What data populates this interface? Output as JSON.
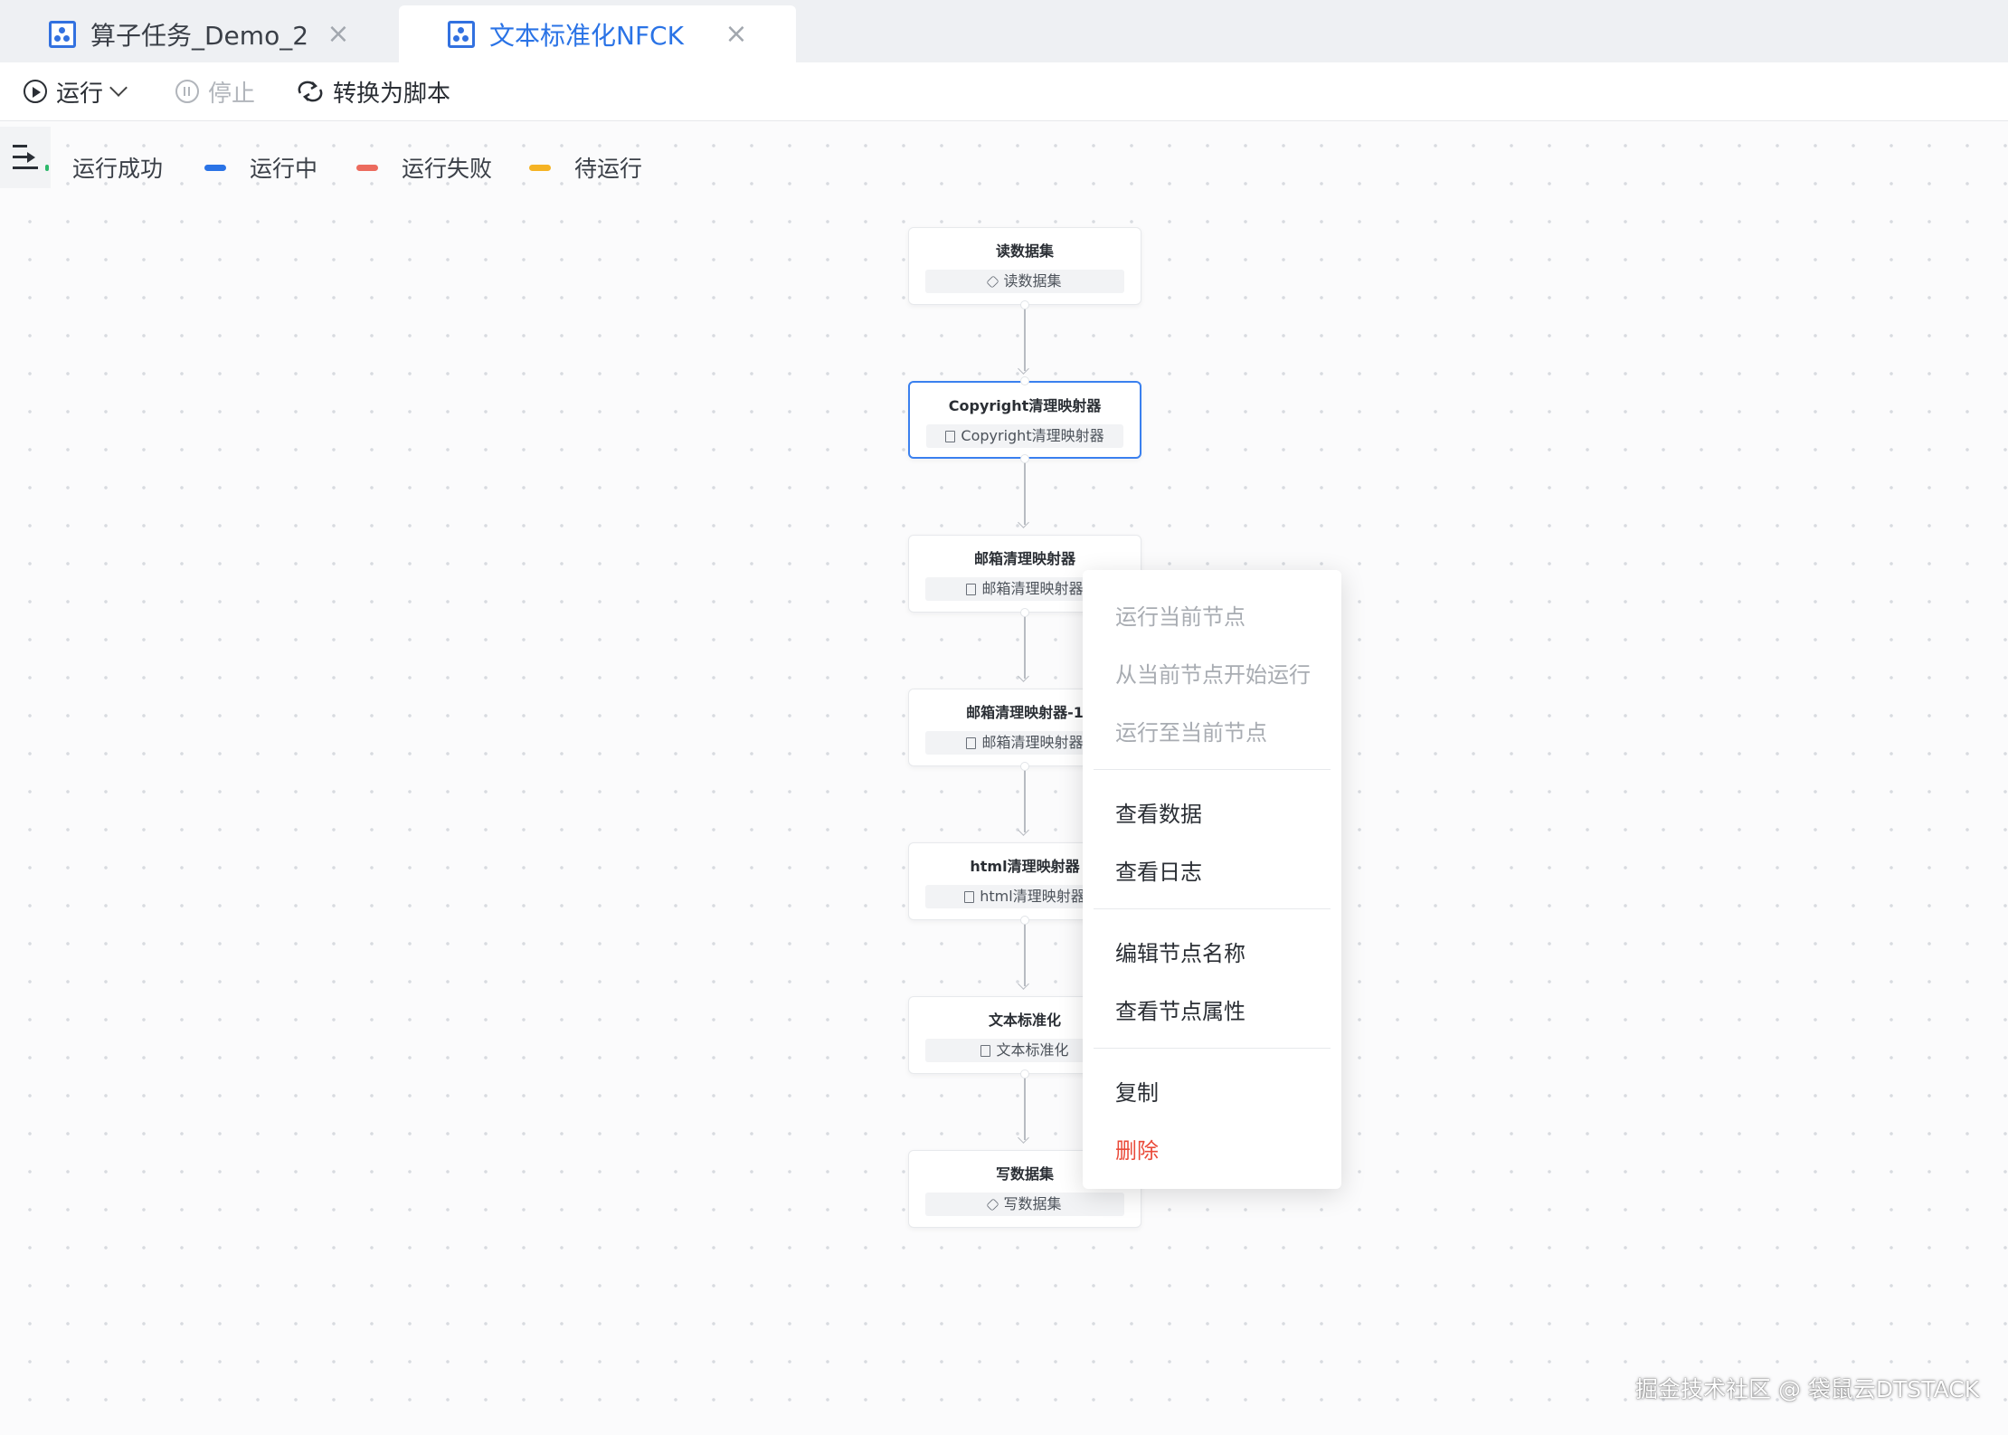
{
  "tabs": [
    {
      "label": "算子任务_Demo_2",
      "active": false
    },
    {
      "label": "文本标准化NFCK",
      "active": true
    }
  ],
  "toolbar": {
    "run_label": "运行",
    "stop_label": "停止",
    "convert_label": "转换为脚本"
  },
  "legend": [
    {
      "label": "运行成功",
      "color": "#2cb86a"
    },
    {
      "label": "运行中",
      "color": "#2a73e6"
    },
    {
      "label": "运行失败",
      "color": "#ec6b5e"
    },
    {
      "label": "待运行",
      "color": "#f5b324"
    }
  ],
  "nodes": [
    {
      "title": "读数据集",
      "subtitle": "读数据集",
      "icon": "cube-icon"
    },
    {
      "title": "Copyright清理映射器",
      "subtitle": "Copyright清理映射器",
      "icon": "file-icon",
      "selected": true
    },
    {
      "title": "邮箱清理映射器",
      "subtitle": "邮箱清理映射器",
      "icon": "file-icon"
    },
    {
      "title": "邮箱清理映射器-1",
      "subtitle": "邮箱清理映射器",
      "icon": "file-icon"
    },
    {
      "title": "html清理映射器",
      "subtitle": "html清理映射器",
      "icon": "file-icon"
    },
    {
      "title": "文本标准化",
      "subtitle": "文本标准化",
      "icon": "file-icon"
    },
    {
      "title": "写数据集",
      "subtitle": "写数据集",
      "icon": "cube-icon"
    }
  ],
  "context_menu": {
    "run_current": "运行当前节点",
    "run_from_current": "从当前节点开始运行",
    "run_to_current": "运行至当前节点",
    "view_data": "查看数据",
    "view_log": "查看日志",
    "edit_name": "编辑节点名称",
    "view_props": "查看节点属性",
    "copy": "复制",
    "delete": "删除"
  },
  "watermark": "掘金技术社区 @ 袋鼠云DTSTACK"
}
